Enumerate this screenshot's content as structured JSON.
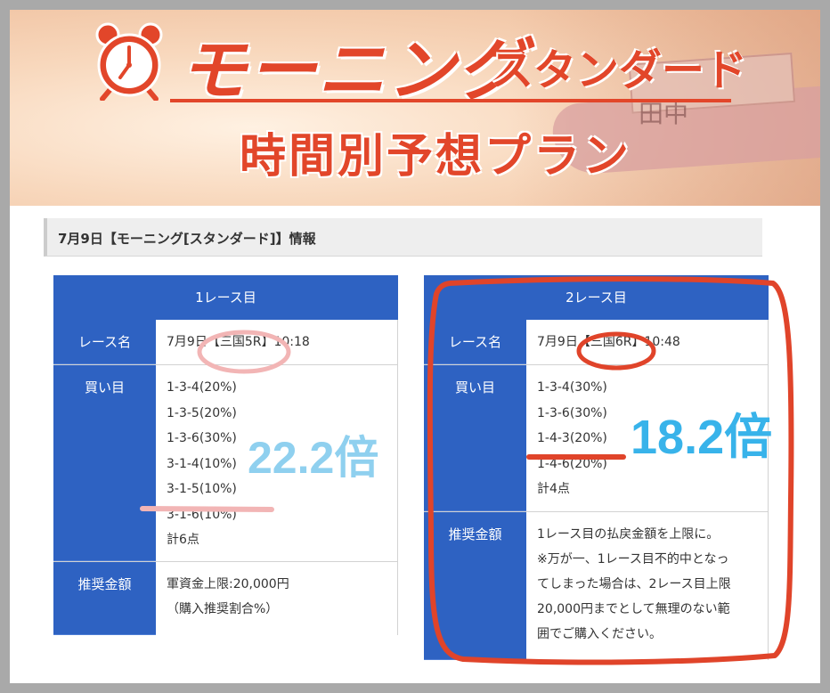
{
  "banner": {
    "title_main": "モーニング",
    "title_sub": "スタンダード",
    "title_plan": "時間別予想プラン",
    "boat_mark": "田中"
  },
  "section": {
    "header": "7月9日【モーニング[スタンダード]】情報"
  },
  "race1": {
    "heading": "1レース目",
    "name_label": "レース名",
    "name_value": "7月9日【三国5R】10:18",
    "bets_label": "買い目",
    "bets": [
      "1-3-4(20%)",
      "1-3-5(20%)",
      "1-3-6(30%)",
      "3-1-4(10%)",
      "3-1-5(10%)",
      "3-1-6(10%)"
    ],
    "total": "計6点",
    "rec_label": "推奨金額",
    "rec_lines": [
      "軍資金上限:20,000円",
      "（購入推奨割合%）"
    ]
  },
  "race2": {
    "heading": "2レース目",
    "name_label": "レース名",
    "name_value": "7月9日【三国6R】10:48",
    "bets_label": "買い目",
    "bets": [
      "1-3-4(30%)",
      "1-3-6(30%)",
      "1-4-3(20%)",
      "1-4-6(20%)"
    ],
    "total": "計4点",
    "rec_label": "推奨金額",
    "rec_lines": [
      "1レース目の払戻金額を上限に。",
      "※万が一、1レース目不的中となっ",
      "てしまった場合は、2レース目上限",
      "20,000円までとして無理のない範",
      "囲でご購入ください。"
    ]
  },
  "annotations": {
    "left_odds": "22.2倍",
    "right_odds": "18.2倍"
  },
  "colors": {
    "brand_red": "#e2462a",
    "table_blue": "#2e62c2",
    "odds_light_blue": "#8fd0ef",
    "odds_blue": "#38b3ea",
    "marker_pink": "#f2b5b5",
    "marker_red": "#e0442a"
  },
  "icons": {
    "clock": "alarm-clock-icon"
  }
}
